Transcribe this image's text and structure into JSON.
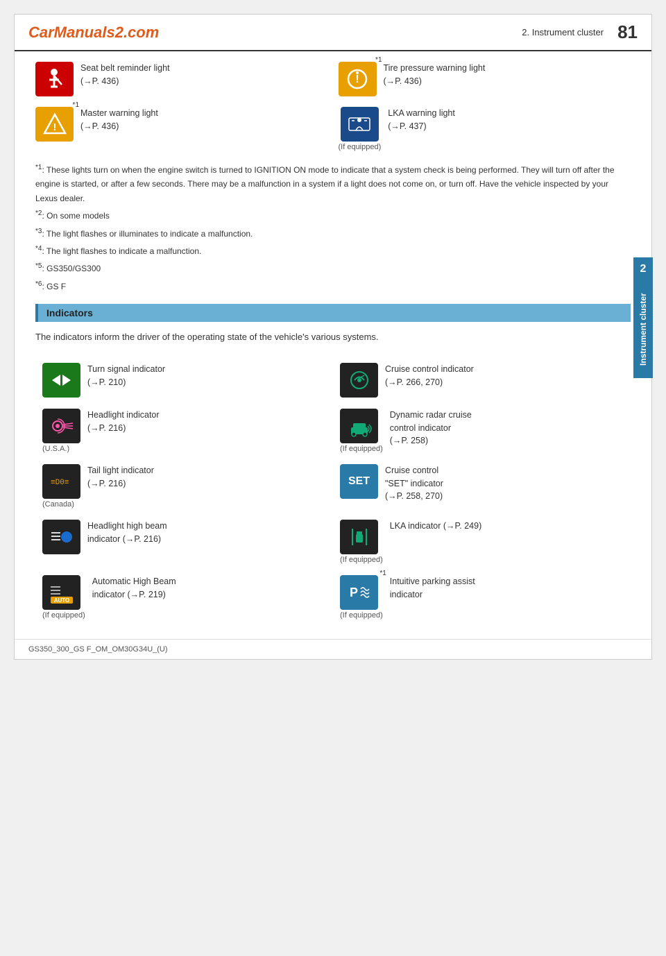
{
  "header": {
    "logo": "CarManuals2.com",
    "chapter": "2. Instrument cluster",
    "page_number": "81"
  },
  "warning_lights": [
    {
      "id": "seat-belt",
      "label": "Seat belt reminder light\n(→P. 436)",
      "superscript": "",
      "icon_type": "seat-belt"
    },
    {
      "id": "tire-pressure",
      "label": "Tire pressure warning light\n(→P. 436)",
      "superscript": "*1",
      "icon_type": "tire-pressure"
    },
    {
      "id": "master-warning",
      "label": "Master warning light\n(→P. 436)",
      "superscript": "*1",
      "icon_type": "master-warning"
    },
    {
      "id": "lka-warning",
      "label": "LKA warning light\n(→P. 437)",
      "superscript": "",
      "sub_label": "(If equipped)",
      "icon_type": "lka-warning"
    }
  ],
  "notes": [
    {
      "key": "*1",
      "text": ": These lights turn on when the engine switch is turned to IGNITION ON mode to indicate that a system check is being performed. They will turn off after the engine is started, or after a few seconds. There may be a malfunction in a system if a light does not come on, or turn off. Have the vehicle inspected by your Lexus dealer."
    },
    {
      "key": "*2",
      "text": ": On some models"
    },
    {
      "key": "*3",
      "text": ": The light flashes or illuminates to indicate a malfunction."
    },
    {
      "key": "*4",
      "text": ": The light flashes to indicate a malfunction."
    },
    {
      "key": "*5",
      "text": ": GS350/GS300"
    },
    {
      "key": "*6",
      "text": ": GS F"
    }
  ],
  "indicators_section": {
    "heading": "Indicators",
    "intro": "The indicators inform the driver of the operating state of the vehicle's various systems."
  },
  "indicators": [
    {
      "id": "turn-signal",
      "label": "Turn signal indicator\n(→P. 210)",
      "sub_label": "",
      "col": "left",
      "icon_type": "turn-signal"
    },
    {
      "id": "cruise-control",
      "label": "Cruise control indicator\n(→P. 266, 270)",
      "sub_label": "",
      "col": "right",
      "icon_type": "cruise-control"
    },
    {
      "id": "headlight-indicator",
      "label": "Headlight indicator\n(→P. 216)",
      "sub_label": "(U.S.A.)",
      "col": "left",
      "icon_type": "headlight"
    },
    {
      "id": "dynamic-radar",
      "label": "Dynamic radar cruise\ncontrol indicator\n(→P. 258)",
      "sub_label": "(If equipped)",
      "col": "right",
      "icon_type": "dynamic-radar"
    },
    {
      "id": "tail-light",
      "label": "Tail light indicator\n(→P. 216)",
      "sub_label": "(Canada)",
      "col": "left",
      "icon_type": "tail-light"
    },
    {
      "id": "cruise-set",
      "label": "Cruise control\n\"SET\" indicator\n(→P. 258, 270)",
      "sub_label": "",
      "col": "right",
      "icon_type": "cruise-set"
    },
    {
      "id": "headlight-high-beam",
      "label": "Headlight high beam\nindicator (→P. 216)",
      "sub_label": "",
      "col": "left",
      "icon_type": "headlight-high-beam"
    },
    {
      "id": "lka-indicator",
      "label": "LKA indicator (→P. 249)",
      "sub_label": "(If equipped)",
      "col": "right",
      "icon_type": "lka-indicator"
    },
    {
      "id": "auto-high-beam",
      "label": "Automatic High Beam\nindicator (→P. 219)",
      "sub_label": "(If equipped)",
      "col": "left",
      "icon_type": "auto-high-beam"
    },
    {
      "id": "intuitive-parking",
      "label": "Intuitive parking assist\nindicator",
      "sub_label": "(If equipped)",
      "superscript": "*1",
      "col": "right",
      "icon_type": "parking-assist"
    }
  ],
  "footer": {
    "text": "GS350_300_GS F_OM_OM30G34U_(U)"
  },
  "side_tab": {
    "number": "2",
    "label": "Instrument cluster"
  }
}
